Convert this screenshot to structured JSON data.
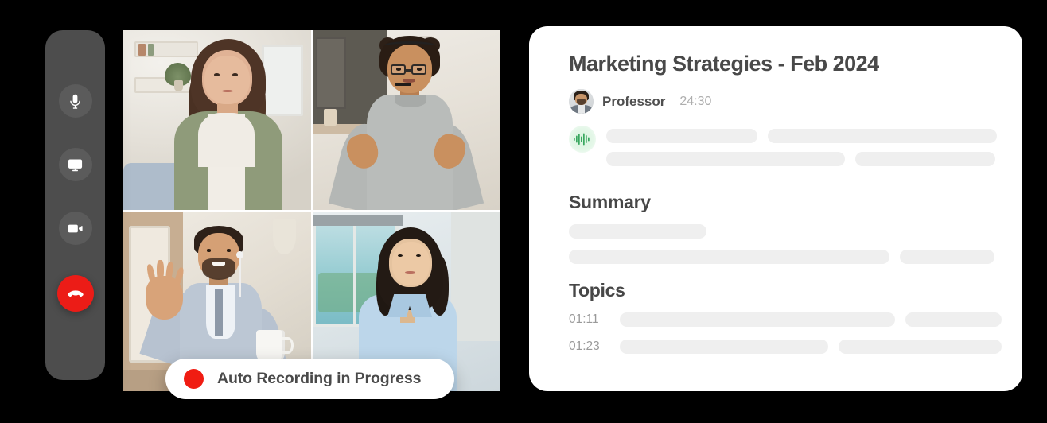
{
  "background_color": "#000000",
  "call_panel": {
    "controls": {
      "buttons": [
        {
          "name": "microphone",
          "icon": "microphone-icon",
          "label": "Microphone",
          "state": "on",
          "color": "#5b5b5b"
        },
        {
          "name": "screen-share",
          "icon": "monitor-icon",
          "label": "Share Screen",
          "state": "on",
          "color": "#5b5b5b"
        },
        {
          "name": "camera",
          "icon": "video-camera-icon",
          "label": "Camera",
          "state": "on",
          "color": "#5b5b5b"
        },
        {
          "name": "end-call",
          "icon": "phone-hangup-icon",
          "label": "End Call",
          "state": "active",
          "color": "#ec1c17"
        }
      ],
      "bar_color": "#4d4d4d"
    },
    "participants": [
      {
        "position": "top-left",
        "description": "Woman with long brown hair in olive cardigan, bookshelf background"
      },
      {
        "position": "top-right",
        "description": "Man with curly hair, glasses and headset, hands raised, kitchen background"
      },
      {
        "position": "bottom-left",
        "description": "Man with earphones waving, holding a white mug"
      },
      {
        "position": "bottom-right",
        "description": "Woman with dark hair in light blue shirt, office window background"
      }
    ],
    "recording_badge": {
      "label": "Auto Recording in Progress",
      "dot_color": "#f01c12",
      "background": "#ffffff"
    }
  },
  "notes_panel": {
    "title": "Marketing Strategies - Feb 2024",
    "speaker": {
      "name": "Professor",
      "timestamp": "24:30",
      "avatar": "professor-avatar"
    },
    "transcript": {
      "icon": "audio-waveform-icon",
      "accent_color": "#3aa860",
      "placeholder_rows": [
        [
          190,
          288
        ],
        [
          300,
          176
        ]
      ]
    },
    "summary": {
      "heading": "Summary",
      "placeholder_rows": [
        [
          173
        ],
        [
          411,
          121
        ]
      ]
    },
    "topics": {
      "heading": "Topics",
      "items": [
        {
          "time": "01:11",
          "placeholder_widths": [
            346,
            121
          ]
        },
        {
          "time": "01:23",
          "placeholder_widths": [
            262,
            205
          ]
        }
      ]
    },
    "skeleton_color": "#efefef"
  }
}
